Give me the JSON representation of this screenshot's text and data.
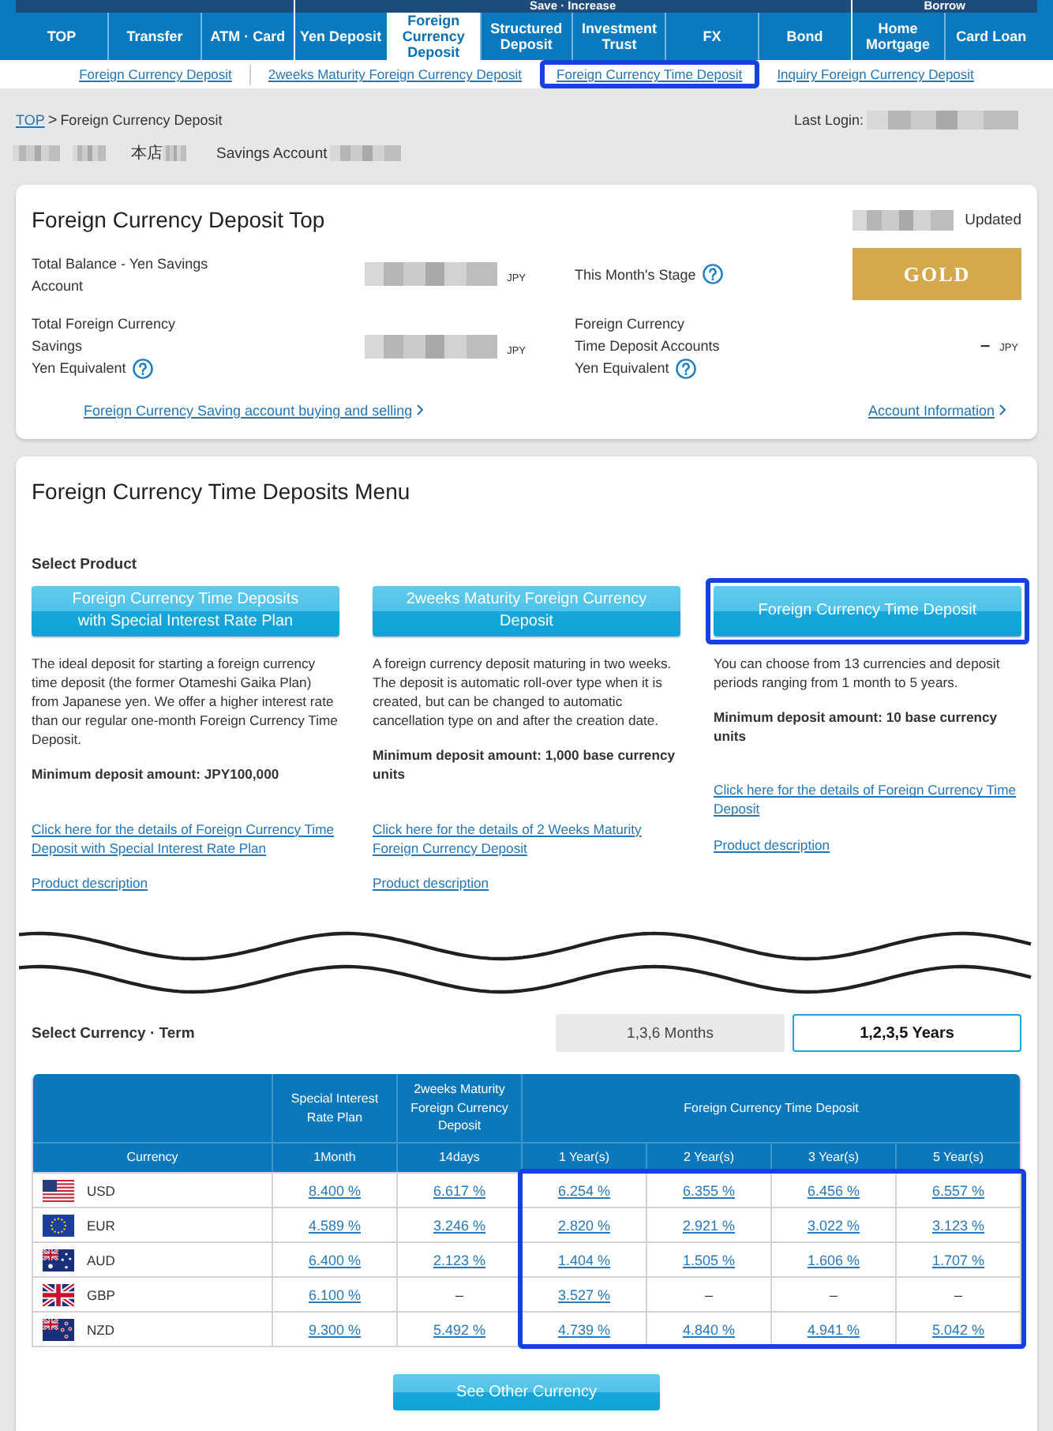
{
  "nav": {
    "groups": [
      {
        "items": [
          {
            "label": "TOP",
            "selected": false
          },
          {
            "label": "Transfer",
            "selected": false
          },
          {
            "label": "ATM · Card",
            "selected": false
          }
        ]
      },
      {
        "label": "Save · Increase",
        "items": [
          {
            "label": "Yen Deposit",
            "selected": false
          },
          {
            "label": "Foreign Currency Deposit",
            "selected": true
          },
          {
            "label": "Structured Deposit",
            "selected": false
          },
          {
            "label": "Investment Trust",
            "selected": false
          },
          {
            "label": "FX",
            "selected": false
          },
          {
            "label": "Bond",
            "selected": false
          }
        ]
      },
      {
        "label": "Borrow",
        "items": [
          {
            "label": "Home Mortgage",
            "selected": false
          },
          {
            "label": "Card Loan",
            "selected": false
          }
        ]
      }
    ]
  },
  "subnav": {
    "links": [
      {
        "label": "Foreign Currency Deposit",
        "highlighted": false,
        "divider": true
      },
      {
        "label": "2weeks Maturity Foreign Currency Deposit",
        "highlighted": false,
        "divider": false
      },
      {
        "label": "Foreign Currency Time Deposit",
        "highlighted": true,
        "divider": false
      },
      {
        "label": "Inquiry Foreign Currency Deposit",
        "highlighted": false,
        "divider": false
      }
    ]
  },
  "breadcrumb": {
    "items": [
      {
        "label": "TOP",
        "link": true
      },
      {
        "label": "Foreign Currency Deposit",
        "link": false
      }
    ],
    "separator": ">",
    "last_login_label": "Last Login:"
  },
  "account": {
    "branch": "本店",
    "type": "Savings Account"
  },
  "summary": {
    "title": "Foreign Currency Deposit Top",
    "updated_label": "Updated",
    "items": [
      {
        "kind": "amount",
        "label": "Total Balance - Yen Savings\nAccount",
        "help": false,
        "blurred": true,
        "unit": "JPY"
      },
      {
        "kind": "stage",
        "label": "This Month's Stage",
        "help": true,
        "badge": "GOLD"
      },
      {
        "kind": "amount",
        "label": "Total Foreign Currency\nSavings",
        "note": "Yen Equivalent",
        "help": true,
        "blurred": true,
        "unit": "JPY"
      },
      {
        "kind": "amount",
        "label": "Foreign Currency\nTime Deposit Accounts",
        "note": "Yen Equivalent",
        "help": true,
        "blurred": false,
        "value": "–",
        "unit": "JPY"
      }
    ],
    "links": [
      {
        "label": "Foreign Currency Saving account buying and selling"
      },
      {
        "label": "Account Information"
      }
    ]
  },
  "menu": {
    "title": "Foreign Currency Time Deposits Menu",
    "select_product_label": "Select Product",
    "products": [
      {
        "button": "Foreign Currency Time Deposits\nwith Special Interest Rate Plan",
        "highlighted": false,
        "description": "The ideal deposit for starting a foreign currency time deposit (the former Otameshi Gaika Plan) from Japanese yen. We offer a higher interest rate than our regular one-month Foreign Currency Time Deposit.",
        "minimum": "Minimum deposit amount: JPY100,000",
        "details_link": "Click here for the details of Foreign Currency Time Deposit with Special Interest Rate Plan",
        "product_link": "Product description"
      },
      {
        "button": "2weeks Maturity Foreign Currency\nDeposit",
        "highlighted": false,
        "description": "A foreign currency deposit maturing in two weeks. The deposit is automatic roll-over type when it is created, but can be changed to automatic cancellation type on and after the creation date.",
        "minimum": "Minimum deposit amount: 1,000 base currency units",
        "details_link": "Click here for the details of 2 Weeks Maturity Foreign Currency Deposit",
        "product_link": "Product description"
      },
      {
        "button": "Foreign Currency Time Deposit",
        "highlighted": true,
        "description": "You can choose from 13 currencies and deposit periods ranging from 1 month to 5 years.",
        "minimum": "Minimum deposit amount: 10 base currency units",
        "details_link": "Click here for the details of Foreign Currency Time Deposit",
        "product_link": "Product description"
      }
    ]
  },
  "currency_term": {
    "label": "Select Currency · Term",
    "options": [
      {
        "label": "1,3,6 Months",
        "selected": false
      },
      {
        "label": "1,2,3,5 Years",
        "selected": true
      }
    ]
  },
  "rate_table": {
    "currency_header": "Currency",
    "groups": [
      {
        "label": "Special Interest Rate Plan",
        "terms": [
          {
            "label": "1Month",
            "highlighted": false
          }
        ]
      },
      {
        "label": "2weeks Maturity Foreign Currency Deposit",
        "terms": [
          {
            "label": "14days",
            "highlighted": false
          }
        ]
      },
      {
        "label": "Foreign Currency Time Deposit",
        "terms": [
          {
            "label": "1 Year(s)",
            "highlighted": true
          },
          {
            "label": "2 Year(s)",
            "highlighted": true
          },
          {
            "label": "3 Year(s)",
            "highlighted": true
          },
          {
            "label": "5 Year(s)",
            "highlighted": true
          }
        ]
      }
    ],
    "rows": [
      {
        "currency": "USD",
        "kind": "us",
        "rates": [
          {
            "value": "8.400 %",
            "link": true
          },
          {
            "value": "6.617 %",
            "link": true
          },
          {
            "value": "6.254 %",
            "link": true
          },
          {
            "value": "6.355 %",
            "link": true
          },
          {
            "value": "6.456 %",
            "link": true
          },
          {
            "value": "6.557 %",
            "link": true
          }
        ]
      },
      {
        "currency": "EUR",
        "kind": "eu",
        "rates": [
          {
            "value": "4.589 %",
            "link": true
          },
          {
            "value": "3.246 %",
            "link": true
          },
          {
            "value": "2.820 %",
            "link": true
          },
          {
            "value": "2.921 %",
            "link": true
          },
          {
            "value": "3.022 %",
            "link": true
          },
          {
            "value": "3.123 %",
            "link": true
          }
        ]
      },
      {
        "currency": "AUD",
        "kind": "au",
        "rates": [
          {
            "value": "6.400 %",
            "link": true
          },
          {
            "value": "2.123 %",
            "link": true
          },
          {
            "value": "1.404 %",
            "link": true
          },
          {
            "value": "1.505 %",
            "link": true
          },
          {
            "value": "1.606 %",
            "link": true
          },
          {
            "value": "1.707 %",
            "link": true
          }
        ]
      },
      {
        "currency": "GBP",
        "kind": "gb",
        "rates": [
          {
            "value": "6.100 %",
            "link": true
          },
          {
            "value": "–",
            "link": false
          },
          {
            "value": "3.527 %",
            "link": true
          },
          {
            "value": "–",
            "link": false
          },
          {
            "value": "–",
            "link": false
          },
          {
            "value": "–",
            "link": false
          }
        ]
      },
      {
        "currency": "NZD",
        "kind": "nz",
        "rates": [
          {
            "value": "9.300 %",
            "link": true
          },
          {
            "value": "5.492 %",
            "link": true
          },
          {
            "value": "4.739 %",
            "link": true
          },
          {
            "value": "4.840 %",
            "link": true
          },
          {
            "value": "4.941 %",
            "link": true
          },
          {
            "value": "5.042 %",
            "link": true
          }
        ]
      }
    ]
  },
  "other_currency_button": "See Other Currency"
}
